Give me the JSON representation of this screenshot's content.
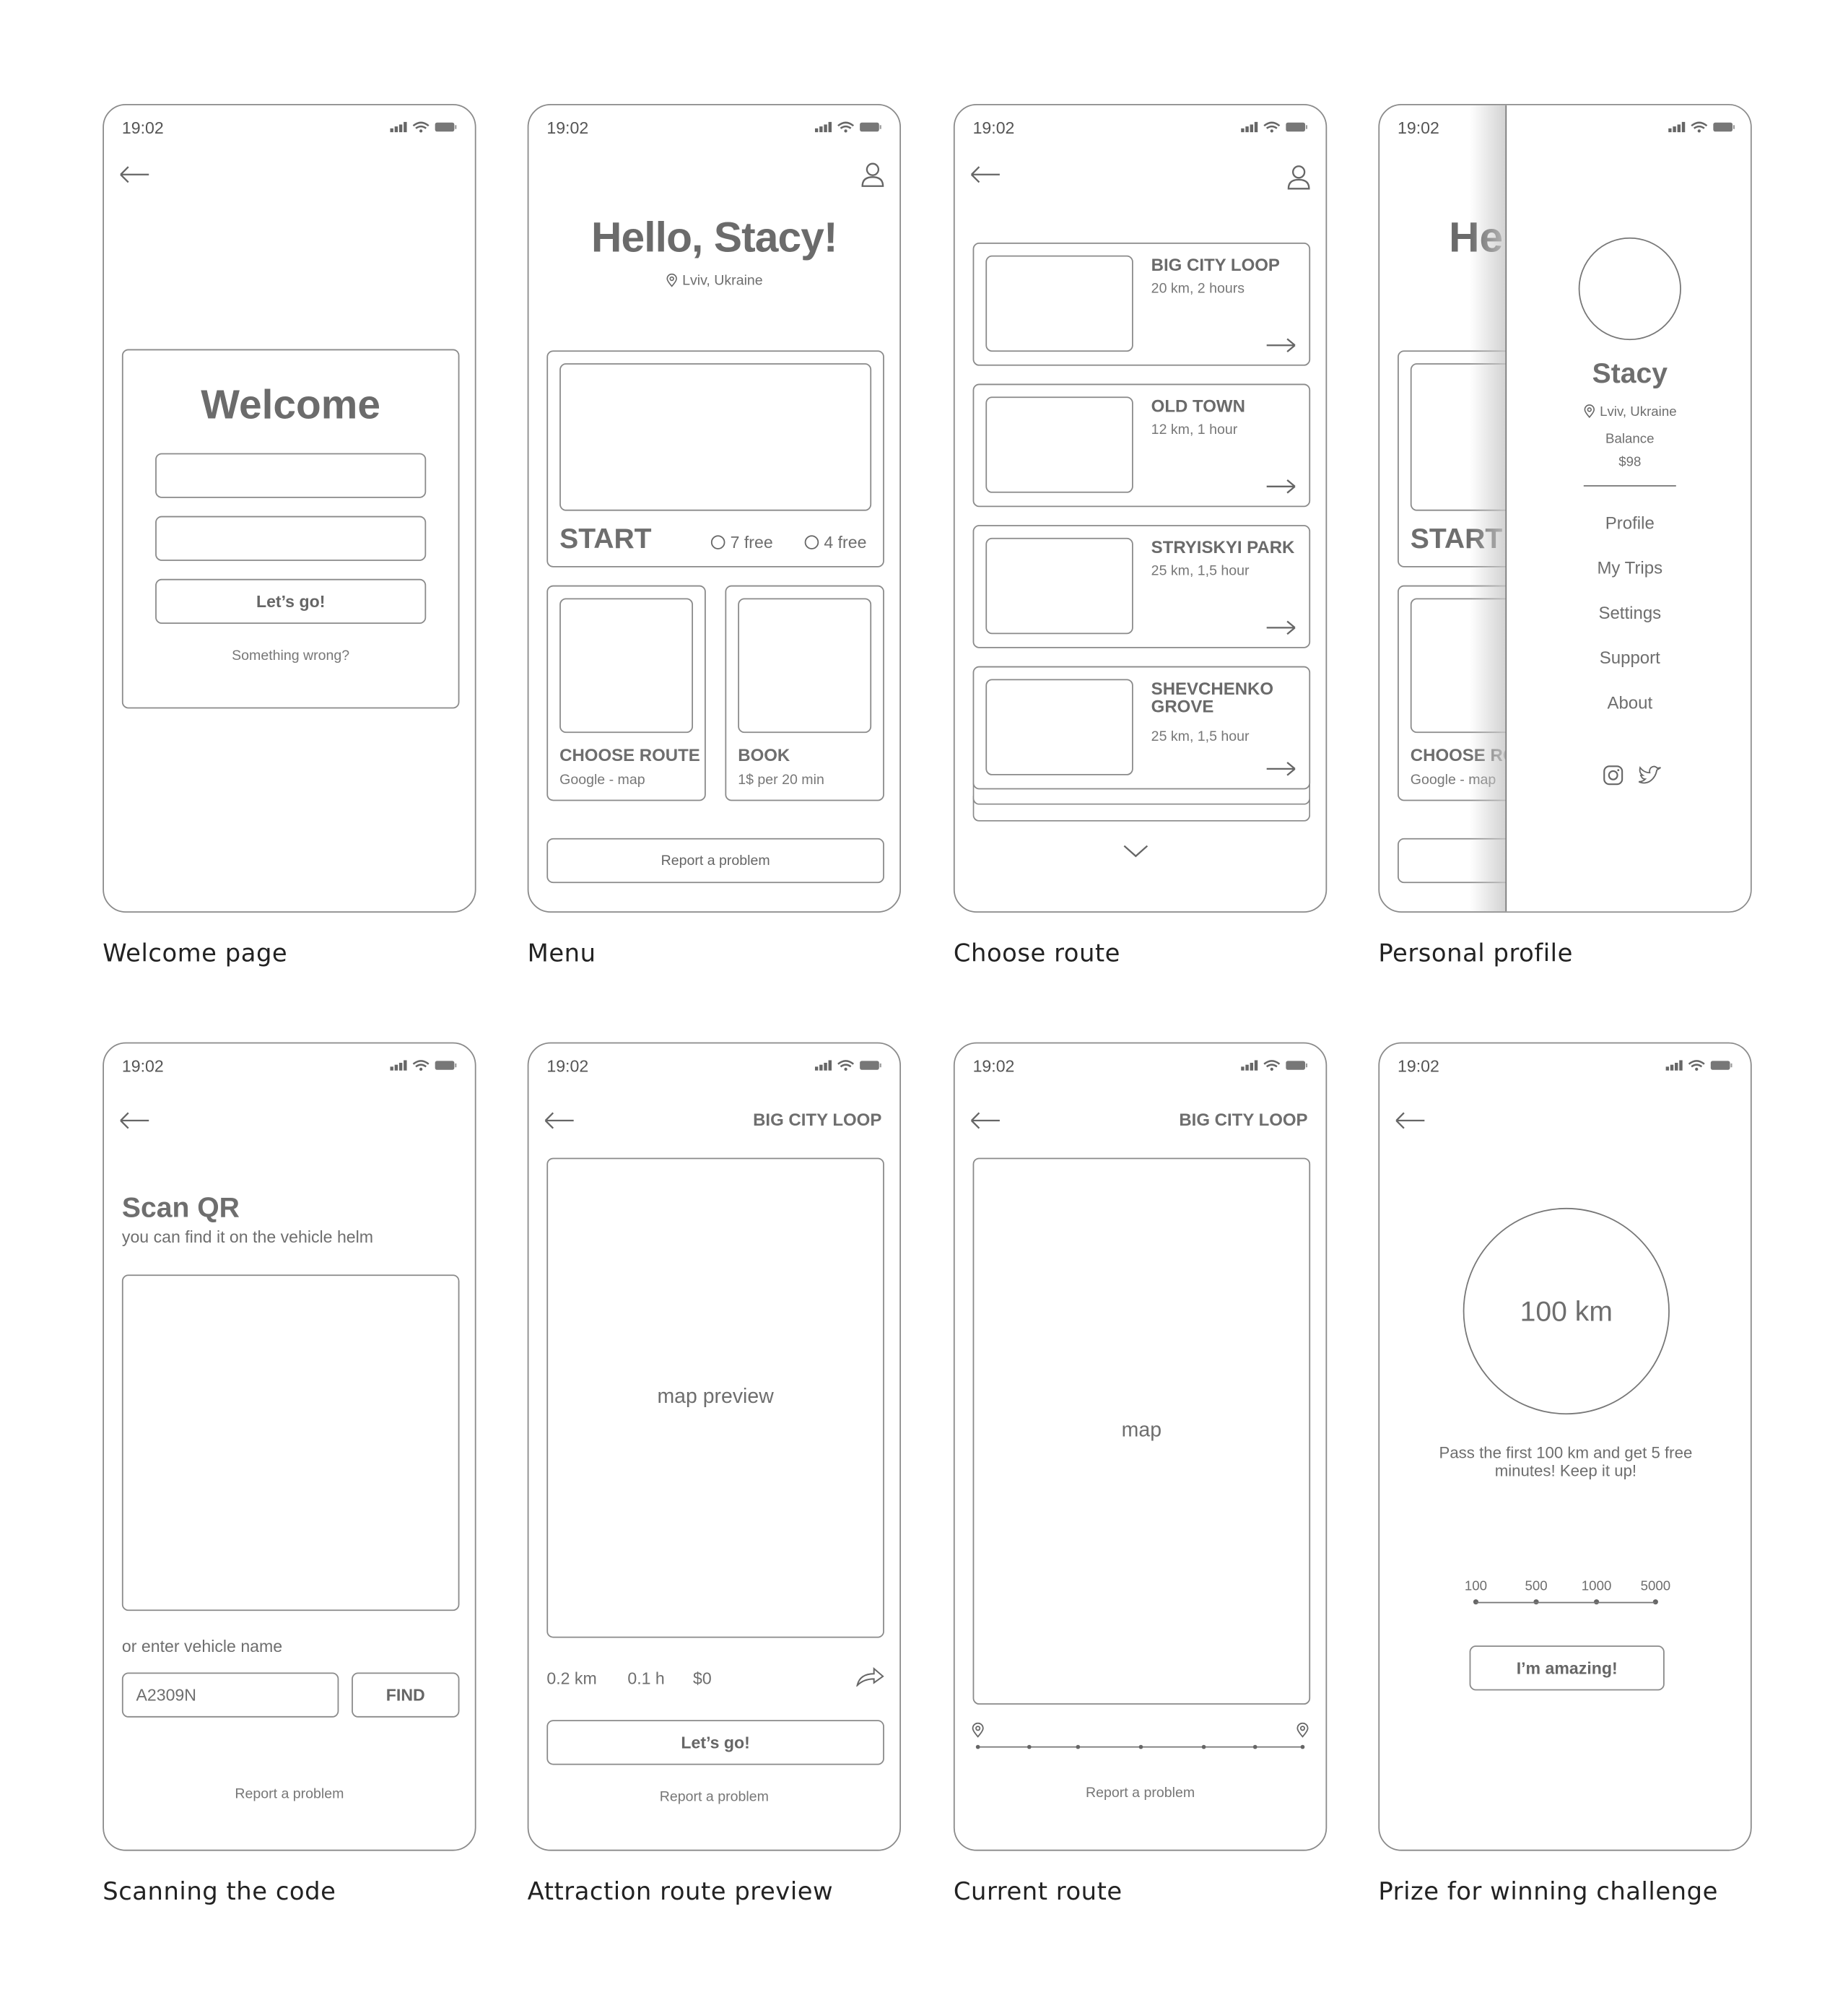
{
  "status_time": "19:02",
  "captions": [
    "Welcome page",
    "Menu",
    "Choose route",
    "Personal profile",
    "Scanning the code",
    "Attraction route preview",
    "Current route",
    "Prize for winning challenge"
  ],
  "welcome": {
    "title": "Welcome",
    "button": "Let’s go!",
    "help_link": "Something wrong?"
  },
  "menu": {
    "greeting": "Hello, Stacy!",
    "location": "Lviv, Ukraine",
    "start": {
      "label": "START",
      "option_1": "7 free",
      "option_2": "4 free"
    },
    "choose_route": {
      "title": "CHOOSE ROUTE",
      "subtitle": "Google - map"
    },
    "book": {
      "title": "BOOK",
      "subtitle": "1$ per 20 min"
    },
    "report": "Report a problem"
  },
  "routes": [
    {
      "title": "BIG CITY LOOP",
      "meta": "20 km, 2 hours"
    },
    {
      "title": "OLD TOWN",
      "meta": "12 km, 1 hour"
    },
    {
      "title": "STRYISKYI PARK",
      "meta": "25 km, 1,5 hour"
    },
    {
      "title": "SHEVCHENKO GROVE",
      "meta": "25 km, 1,5 hour"
    }
  ],
  "profile": {
    "behind_greeting": "He",
    "behind_start": "START",
    "behind_route": "CHOOSE RO",
    "behind_route_sub": "Google - map",
    "name": "Stacy",
    "location": "Lviv, Ukraine",
    "balance_label": "Balance",
    "balance": "$98",
    "menu": [
      "Profile",
      "My Trips",
      "Settings",
      "Support",
      "About"
    ],
    "social_icons": [
      "instagram-icon",
      "twitter-icon"
    ]
  },
  "scan": {
    "title": "Scan QR",
    "subtitle": "you can find it on the vehicle helm",
    "alt_label": "or enter vehicle name",
    "vehicle_value": "A2309N",
    "find": "FIND",
    "report": "Report a problem"
  },
  "preview": {
    "title": "BIG CITY LOOP",
    "map_label": "map preview",
    "distance": "0.2 km",
    "time": "0.1 h",
    "price": "$0",
    "button": "Let’s go!",
    "report": "Report a problem"
  },
  "current": {
    "title": "BIG CITY LOOP",
    "map_label": "map",
    "report": "Report a problem"
  },
  "prize": {
    "value": "100 km",
    "message": "Pass the first 100 km and get 5 free minutes! Keep it up!",
    "milestones": [
      "100",
      "500",
      "1000",
      "5000"
    ],
    "button": "I’m amazing!"
  }
}
